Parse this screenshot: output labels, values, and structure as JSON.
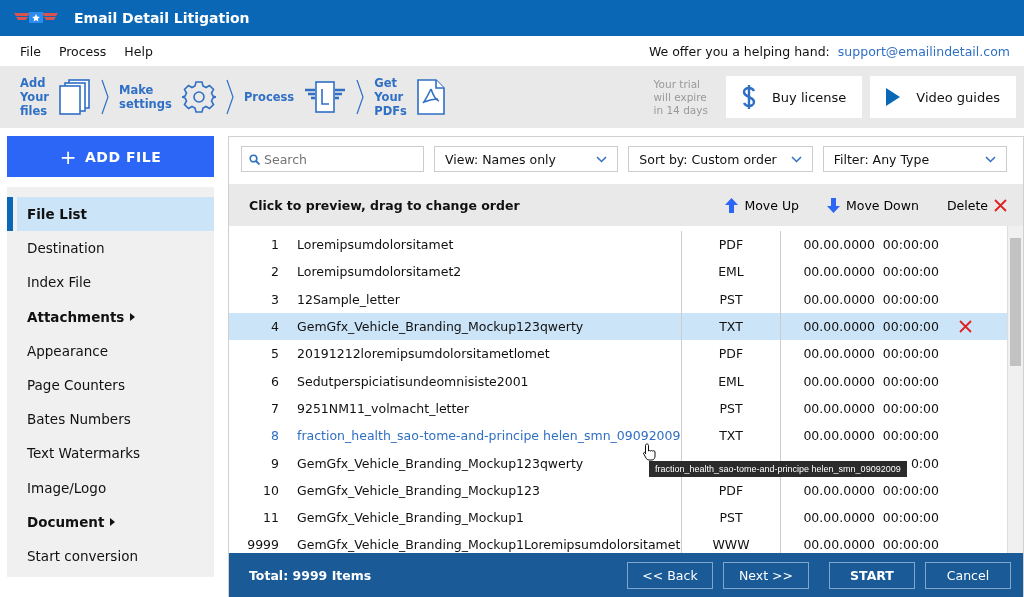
{
  "window": {
    "title": "Email Detail Litigation"
  },
  "menu": [
    "File",
    "Process",
    "Help"
  ],
  "help": {
    "text": "We offer you a helping hand:",
    "link": "support@emailindetail.com"
  },
  "steps": [
    {
      "label": "Add\nYour\nfiles",
      "kind": "files"
    },
    {
      "label": "Make\nsettings",
      "kind": "gear"
    },
    {
      "label": "Process",
      "kind": "process"
    },
    {
      "label": "Get\nYour\nPDFs",
      "kind": "pdf"
    }
  ],
  "trial": "Your trial\nwill expire\nin 14 days",
  "actions": [
    {
      "label": "Buy license",
      "kind": "dollar"
    },
    {
      "label": "Video guides",
      "kind": "play"
    }
  ],
  "add_file": {
    "icon": "+",
    "label": "ADD FILE"
  },
  "sidebar": {
    "items": [
      {
        "label": "File List",
        "kind": "page",
        "selected": true
      },
      {
        "label": "Destination",
        "kind": "page",
        "selected": false
      },
      {
        "label": "Index File",
        "kind": "page",
        "selected": false
      },
      {
        "label": "Attachments",
        "kind": "group",
        "selected": false
      },
      {
        "label": "Appearance",
        "kind": "page",
        "selected": false
      },
      {
        "label": "Page Counters",
        "kind": "page",
        "selected": false
      },
      {
        "label": "Bates Numbers",
        "kind": "page",
        "selected": false
      },
      {
        "label": "Text Watermarks",
        "kind": "page",
        "selected": false
      },
      {
        "label": "Image/Logo",
        "kind": "page",
        "selected": false
      },
      {
        "label": "Document",
        "kind": "group",
        "selected": false
      },
      {
        "label": "Start conversion",
        "kind": "page",
        "selected": false
      }
    ]
  },
  "search": {
    "placeholder": "Search"
  },
  "dropdowns": [
    "View: Names only",
    "Sort by: Custom order",
    "Filter: Any Type"
  ],
  "list_header": {
    "hint": "Click to preview, drag to change order",
    "buttons": [
      {
        "label": "Move Up",
        "kind": "up"
      },
      {
        "label": "Move Down",
        "kind": "down"
      },
      {
        "label": "Delete",
        "kind": "delete"
      }
    ]
  },
  "rows": [
    {
      "number": "1",
      "name": "Loremipsumdolorsitamet",
      "type": "PDF",
      "date": "00.00.0000",
      "time": "00:00:00",
      "selected": false,
      "hovered": false
    },
    {
      "number": "2",
      "name": "Loremipsumdolorsitamet2",
      "type": "EML",
      "date": "00.00.0000",
      "time": "00:00:00",
      "selected": false,
      "hovered": false
    },
    {
      "number": "3",
      "name": "12Sample_letter",
      "type": "PST",
      "date": "00.00.0000",
      "time": "00:00:00",
      "selected": false,
      "hovered": false
    },
    {
      "number": "4",
      "name": "GemGfx_Vehicle_Branding_Mockup123qwerty",
      "type": "TXT",
      "date": "00.00.0000",
      "time": "00:00:00",
      "selected": true,
      "hovered": false
    },
    {
      "number": "5",
      "name": "20191212loremipsumdolorsitametlomet",
      "type": "PDF",
      "date": "00.00.0000",
      "time": "00:00:00",
      "selected": false,
      "hovered": false
    },
    {
      "number": "6",
      "name": "Sedutperspiciatisundeomnisiste2001",
      "type": "EML",
      "date": "00.00.0000",
      "time": "00:00:00",
      "selected": false,
      "hovered": false
    },
    {
      "number": "7",
      "name": "9251NM11_volmacht_letter",
      "type": "PST",
      "date": "00.00.0000",
      "time": "00:00:00",
      "selected": false,
      "hovered": false
    },
    {
      "number": "8",
      "name": "fraction_health_sao-tome-and-principe helen_smn_09092009",
      "type": "TXT",
      "date": "00.00.0000",
      "time": "00:00:00",
      "selected": false,
      "hovered": true
    },
    {
      "number": "9",
      "name": "GemGfx_Vehicle_Branding_Mockup123qwerty",
      "time": "0:00",
      "selected": false,
      "hovered": false
    },
    {
      "number": "10",
      "name": "GemGfx_Vehicle_Branding_Mockup123",
      "type": "PDF",
      "date": "00.00.0000",
      "time": "00:00:00",
      "selected": false,
      "hovered": false
    },
    {
      "number": "11",
      "name": "GemGfx_Vehicle_Branding_Mockup1",
      "type": "PST",
      "date": "00.00.0000",
      "time": "00:00:00",
      "selected": false,
      "hovered": false
    },
    {
      "number": "9999",
      "name": "GemGfx_Vehicle_Branding_Mockup1Loremipsumdolorsitamet",
      "type": "WWW",
      "date": "00.00.0000",
      "time": "00:00:00",
      "selected": false,
      "hovered": false
    }
  ],
  "tooltip": "fraction_health_sao-tome-and-principe helen_smn_09092009",
  "footer": {
    "total": "Total: 9999 Items",
    "buttons": [
      {
        "label": "<< Back",
        "kind": "nav"
      },
      {
        "label": "Next >>",
        "kind": "nav"
      },
      {
        "label": "START",
        "kind": "primary"
      },
      {
        "label": "Cancel",
        "kind": "nav"
      }
    ]
  }
}
